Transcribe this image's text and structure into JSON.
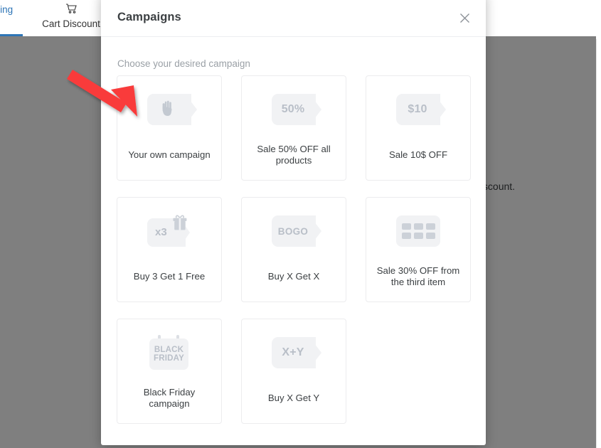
{
  "background": {
    "tabs": [
      {
        "label": "ricing",
        "icon": "",
        "active": true
      },
      {
        "label": "Cart Discount",
        "icon": "cart-icon",
        "active": false
      }
    ],
    "partial_text": "e or discount."
  },
  "modal": {
    "title": "Campaigns",
    "close_label": "×",
    "subtitle": "Choose your desired campaign",
    "campaigns": [
      {
        "label": "Your own campaign",
        "icon": "hand-icon",
        "badge": ""
      },
      {
        "label": "Sale 50% OFF all products",
        "icon": "tag-icon",
        "badge": "50%"
      },
      {
        "label": "Sale 10$ OFF",
        "icon": "tag-icon",
        "badge": "$10"
      },
      {
        "label": "Buy 3 Get 1 Free",
        "icon": "gift-tag-icon",
        "badge": "x3"
      },
      {
        "label": "Buy X Get X",
        "icon": "tag-icon",
        "badge": "BOGO"
      },
      {
        "label": "Sale 30% OFF from the third item",
        "icon": "grid-icon",
        "badge": ""
      },
      {
        "label": "Black Friday campaign",
        "icon": "calendar-icon",
        "badge": "BLACK FRIDAY"
      },
      {
        "label": "Buy X Get Y",
        "icon": "tag-icon",
        "badge": "X+Y"
      }
    ]
  },
  "annotation": {
    "arrow_color": "#f93b3b"
  },
  "colors": {
    "accent": "#2e75b6",
    "badge_bg": "#f1f2f4",
    "badge_fg": "#b9bfc8",
    "text": "#3c4043",
    "muted": "#9aa0a6",
    "card_border": "#ececee"
  }
}
